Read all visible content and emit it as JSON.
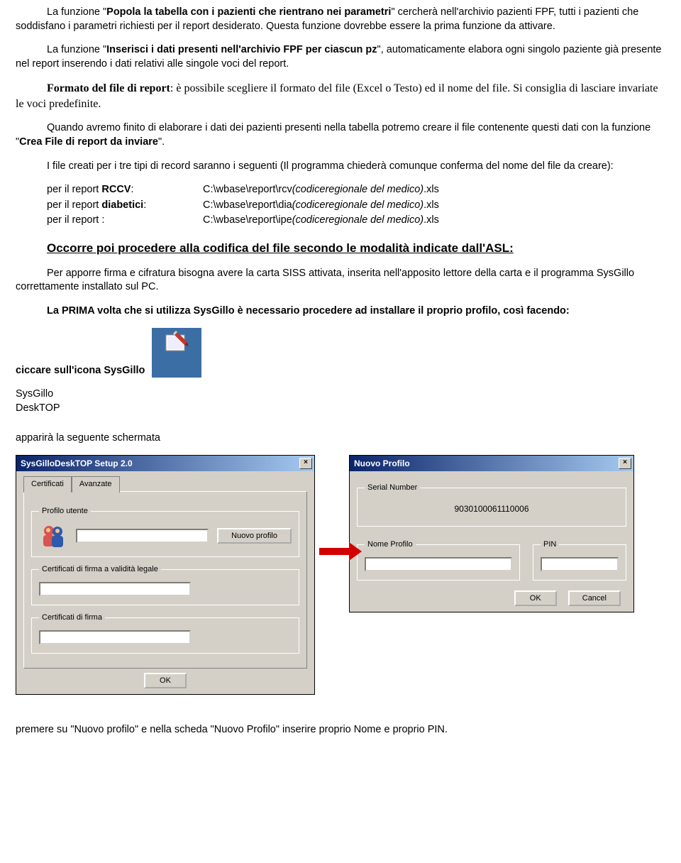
{
  "paragraphs": {
    "p1a": "La funzione \"",
    "p1b": "Popola la tabella con i pazienti che rientrano nei parametri",
    "p1c": "\" cercherà nell'archivio pazienti FPF, tutti i pazienti che soddisfano i parametri richiesti per il report desiderato. Questa funzione dovrebbe essere la prima funzione da attivare.",
    "p2a": "La funzione \"",
    "p2b": "Inserisci i dati presenti nell'archivio FPF per ciascun pz",
    "p2c": "\", automaticamente elabora ogni singolo paziente già presente nel report inserendo i dati relativi alle singole voci del report.",
    "p3a": "Formato del file di report",
    "p3b": ": è possibile scegliere il formato del file (Excel o Testo) ed il nome del file. Si consiglia di lasciare invariate le voci predefinite.",
    "p4a": "Quando avremo finito di elaborare i dati dei pazienti presenti nella tabella potremo creare il file contenente questi dati con la funzione \"",
    "p4b": "Crea File di report da inviare",
    "p4c": "\".",
    "p5": "I file creati per i tre tipi di record saranno i seguenti (Il programma chiederà comunque conferma del nome del file da creare):",
    "files": [
      {
        "label_pre": "per il report ",
        "label_b": "RCCV",
        "label_post": ":",
        "path_pre": "C:\\wbase\\report\\rcv",
        "path_it": "(codiceregionale del medico)",
        "path_post": ".xls"
      },
      {
        "label_pre": "per il report ",
        "label_b": "diabetici",
        "label_post": ":",
        "path_pre": "C:\\wbase\\report\\dia",
        "path_it": "(codiceregionale del medico)",
        "path_post": ".xls"
      },
      {
        "label_pre": "per il report  :",
        "label_b": "",
        "label_post": "",
        "path_pre": "C:\\wbase\\report\\ipe",
        "path_it": "(codiceregionale del medico)",
        "path_post": ".xls"
      }
    ],
    "h_asl": "Occorre poi procedere alla codifica del file secondo le modalità indicate dall'ASL:",
    "p6": "Per apporre firma e cifratura bisogna avere la carta SISS attivata, inserita nell'apposito lettore della carta e il programma SysGillo correttamente installato sul PC.",
    "p7": "La PRIMA volta che si utilizza SysGillo è necessario procedere ad installare il proprio profilo, così facendo:",
    "p8": "ciccare sull'icona SysGillo",
    "p9": "apparirà la seguente schermata",
    "p10": "premere su \"Nuovo profilo\" e nella scheda \"Nuovo Profilo\" inserire proprio Nome e proprio PIN."
  },
  "deskicon": {
    "line1": "SysGillo",
    "line2": "DeskTOP"
  },
  "dialogA": {
    "title": "SysGilloDeskTOP Setup 2.0",
    "tab1": "Certificati",
    "tab2": "Avanzate",
    "grp1": "Profilo utente",
    "btn_nuovo": "Nuovo profilo",
    "grp2": "Certificati di firma a validità legale",
    "grp3": "Certificati di firma",
    "ok": "OK"
  },
  "dialogB": {
    "title": "Nuovo Profilo",
    "grp_sn": "Serial Number",
    "sn": "9030100061110006",
    "grp_np": "Nome Profilo",
    "grp_pin": "PIN",
    "ok": "OK",
    "cancel": "Cancel"
  }
}
